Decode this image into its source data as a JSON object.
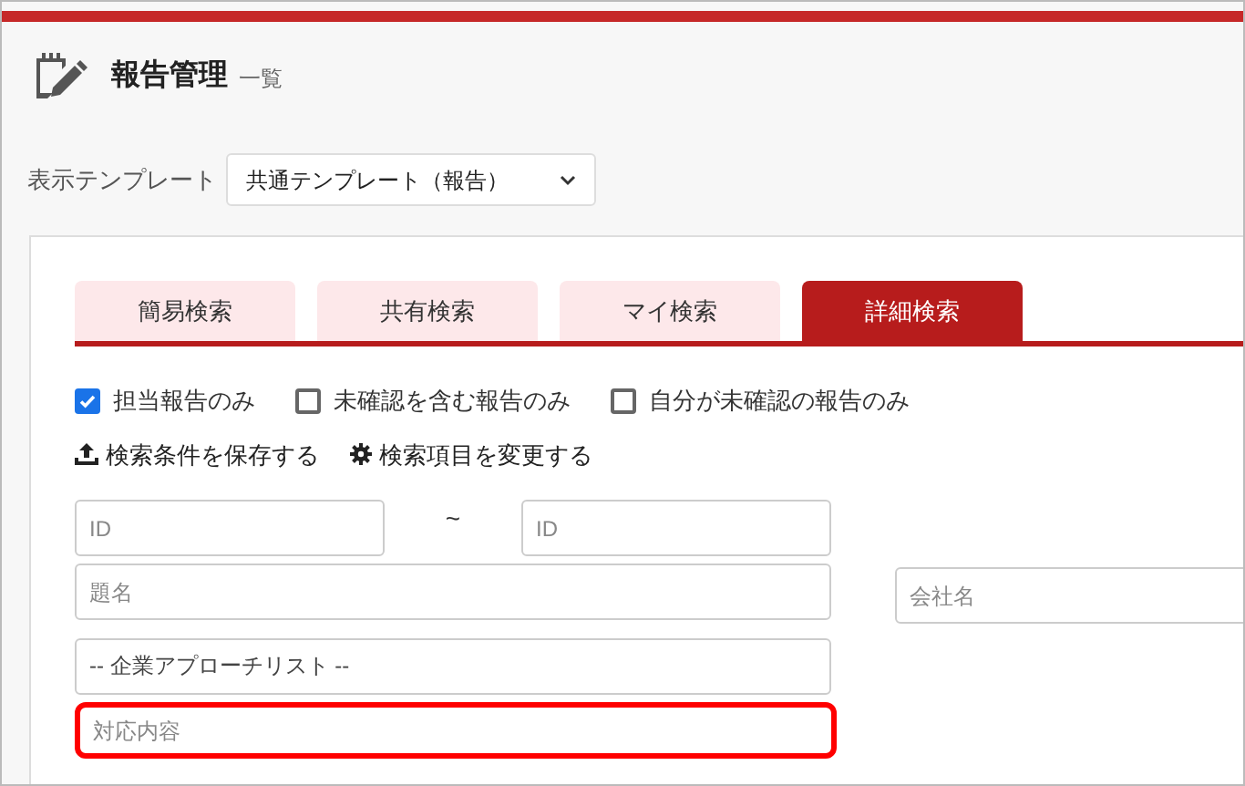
{
  "header": {
    "title": "報告管理",
    "subtitle": "一覧"
  },
  "template": {
    "label": "表示テンプレート",
    "value": "共通テンプレート（報告）"
  },
  "tabs": [
    {
      "label": "簡易検索",
      "selected": false
    },
    {
      "label": "共有検索",
      "selected": false
    },
    {
      "label": "マイ検索",
      "selected": false
    },
    {
      "label": "詳細検索",
      "selected": true
    }
  ],
  "filters": [
    {
      "label": "担当報告のみ",
      "checked": true
    },
    {
      "label": "未確認を含む報告のみ",
      "checked": false
    },
    {
      "label": "自分が未確認の報告のみ",
      "checked": false
    }
  ],
  "actions": [
    {
      "kind": "upload",
      "label": "検索条件を保存する"
    },
    {
      "kind": "gear",
      "label": "検索項目を変更する"
    }
  ],
  "id_range": {
    "from": {
      "placeholder": "ID"
    },
    "separator": "~",
    "to": {
      "placeholder": "ID"
    }
  },
  "fields": [
    {
      "placeholder": "題名",
      "highlighted": false
    },
    {
      "value": "-- 企業アプローチリスト --",
      "highlighted": false
    },
    {
      "placeholder": "対応内容",
      "highlighted": true
    }
  ],
  "company_field": {
    "placeholder": "会社名"
  }
}
